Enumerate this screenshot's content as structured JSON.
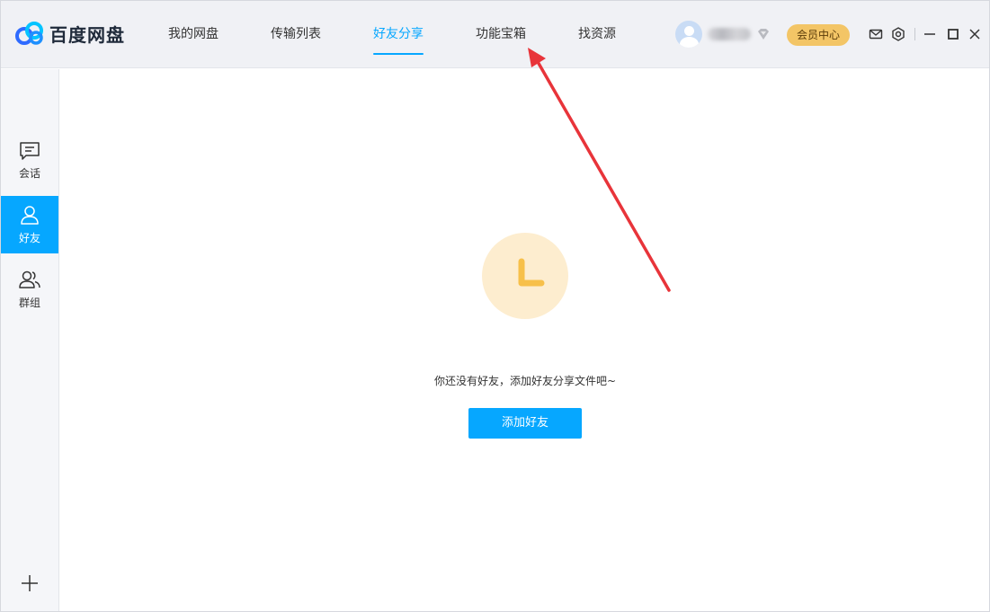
{
  "app": {
    "logo_text": "百度网盘"
  },
  "nav": {
    "items": [
      {
        "label": "我的网盘"
      },
      {
        "label": "传输列表"
      },
      {
        "label": "好友分享",
        "active": true
      },
      {
        "label": "功能宝箱"
      },
      {
        "label": "找资源"
      }
    ]
  },
  "header": {
    "vip_label": "会员中心"
  },
  "sidebar": {
    "items": [
      {
        "label": "会话",
        "icon": "chat-icon"
      },
      {
        "label": "好友",
        "icon": "user-icon",
        "active": true
      },
      {
        "label": "群组",
        "icon": "group-icon"
      }
    ]
  },
  "main": {
    "empty_message": "你还没有好友，添加好友分享文件吧~",
    "add_friend_label": "添加好友"
  },
  "colors": {
    "accent": "#06a7ff",
    "vip": "#f3c566",
    "empty_circle": "#fdedcf",
    "empty_icon": "#f7c04a",
    "arrow": "#e8343a"
  }
}
